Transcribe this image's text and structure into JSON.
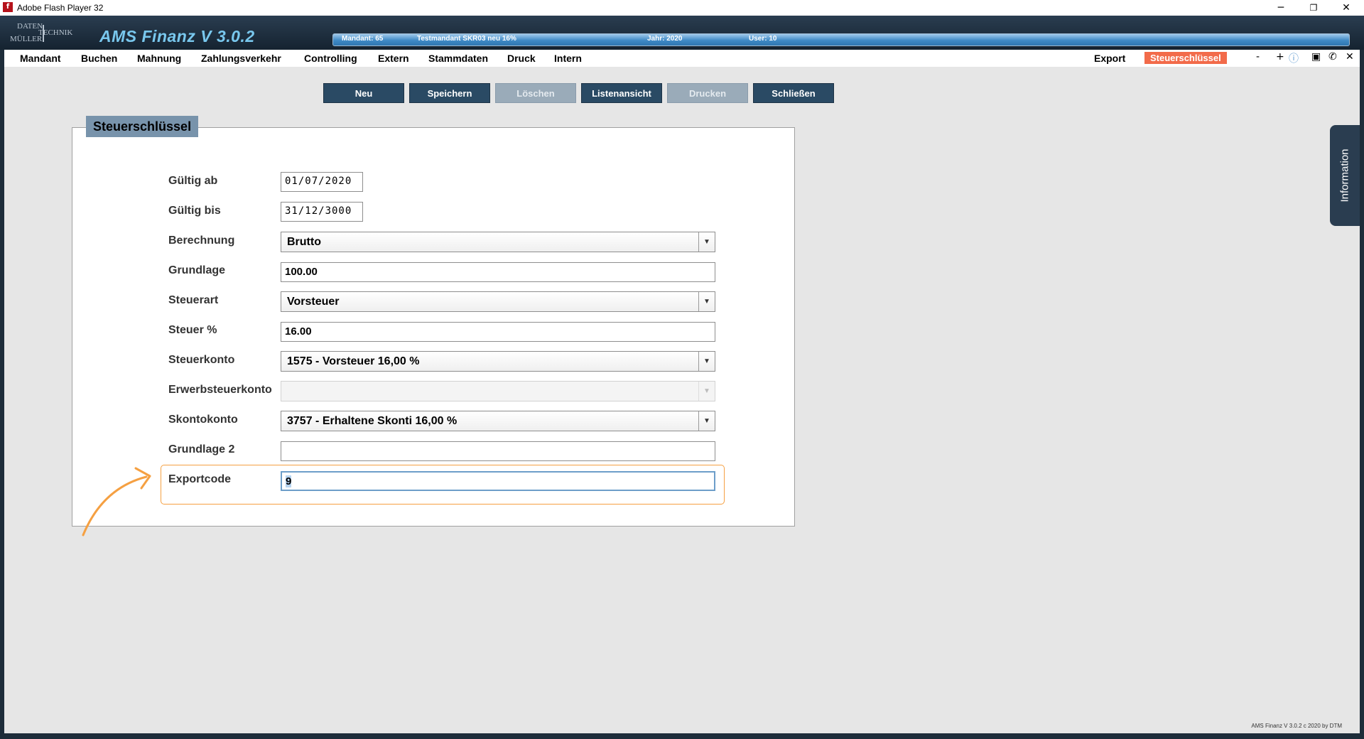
{
  "window": {
    "title": "Adobe Flash Player 32",
    "icon": "flash-icon",
    "controls": [
      "minimize-icon",
      "restore-icon",
      "close-icon"
    ]
  },
  "header": {
    "logo_lines": [
      "DATEN",
      "TECHNIK",
      "MÜLLER"
    ],
    "app_title": "AMS Finanz V 3.0.2",
    "info": {
      "mandant": "Mandant: 65",
      "testmandant": "Testmandant SKR03 neu 16%",
      "jahr": "Jahr: 2020",
      "user": "User: 10"
    }
  },
  "menu": {
    "items": [
      "Mandant",
      "Buchen",
      "Mahnung",
      "Zahlungsverkehr",
      "Controlling",
      "Extern",
      "Stammdaten",
      "Druck",
      "Intern"
    ],
    "export": "Export",
    "active": "Steuerschlüssel",
    "icons": [
      "minus-icon",
      "plus-icon",
      "help-icon",
      "save-icon",
      "phone-icon",
      "close-icon"
    ]
  },
  "toolbar": {
    "neu": "Neu",
    "speichern": "Speichern",
    "loeschen": "Löschen",
    "listenansicht": "Listenansicht",
    "drucken": "Drucken",
    "schliessen": "Schließen"
  },
  "panel": {
    "title": "Steuerschlüssel"
  },
  "form": {
    "gueltig_ab": {
      "label": "Gültig ab",
      "value": "01/07/2020"
    },
    "gueltig_bis": {
      "label": "Gültig bis",
      "value": "31/12/3000"
    },
    "berechnung": {
      "label": "Berechnung",
      "value": "Brutto"
    },
    "grundlage": {
      "label": "Grundlage",
      "value": "100.00"
    },
    "steuerart": {
      "label": "Steuerart",
      "value": "Vorsteuer"
    },
    "steuer_pct": {
      "label": "Steuer %",
      "value": "16.00"
    },
    "steuerkonto": {
      "label": "Steuerkonto",
      "value": "1575 - Vorsteuer 16,00 %"
    },
    "erwerbsteuerkonto": {
      "label": "Erwerbsteuerkonto",
      "value": ""
    },
    "skontokonto": {
      "label": "Skontokonto",
      "value": "3757 - Erhaltene Skonti 16,00 %"
    },
    "grundlage2": {
      "label": "Grundlage 2",
      "value": ""
    },
    "exportcode": {
      "label": "Exportcode",
      "value": "9"
    }
  },
  "info_tab": "Information",
  "footer": "AMS Finanz V 3.0.2 c  2020 by DTM",
  "colors": {
    "header": "#1e2d3a",
    "active_tab": "#f26b4a",
    "button": "#2a4a64",
    "button_disabled": "#9aabb9",
    "annotation": "#f5a042"
  }
}
